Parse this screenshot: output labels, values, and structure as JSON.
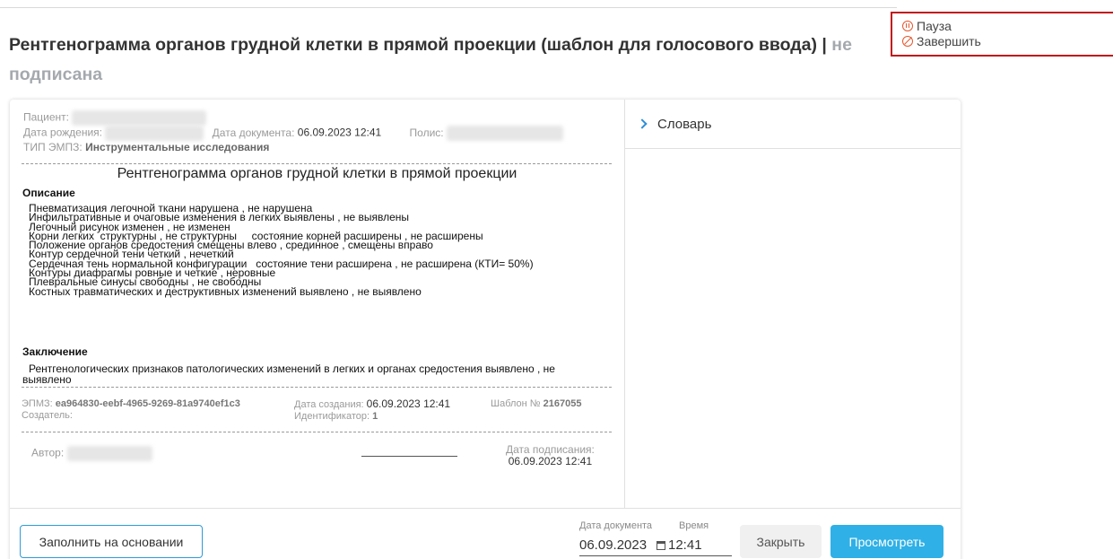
{
  "header": {
    "title": "Рентгенограмма органов грудной клетки в прямой проекции (шаблон для голосового ввода) |",
    "status": "не подписана"
  },
  "dictation": {
    "pause_label": "Пауза",
    "finish_label": "Завершить"
  },
  "doc": {
    "patient_label": "Пациент:",
    "dob_label": "Дата рождения:",
    "doc_date_label": "Дата документа:",
    "doc_date_value": "06.09.2023 12:41",
    "policy_label": "Полис:",
    "emp_type_label": "ТИП ЭМПЗ:",
    "emp_type_value": "Инструментальные исследования",
    "title": "Рентгенограмма органов грудной клетки в прямой проекции",
    "description_header": "Описание",
    "description_lines": [
      "Пневматизация легочной ткани нарушена , не нарушена",
      "Инфильтративные и очаговые изменения в легких выявлены , не выявлены",
      "Легочный рисунок изменен , не изменен",
      "Корни легких  структурны , не структурны     состояние корней расширены , не расширены",
      "Положение органов средостения смещены влево , срединное , смещены вправо",
      "Контур сердечной тени четкий , нечеткий",
      "Сердечная тень нормальной конфигурации   состояние тени расширена , не расширена (КТИ= 50%)",
      "Контуры диафрагмы ровные и четкие , неровные",
      "Плевральные синусы свободны , не свободны",
      "Костных травматических и деструктивных изменений выявлено , не выявлено"
    ],
    "conclusion_header": "Заключение",
    "conclusion_text": "Рентгенологических признаков патологических изменений в легких и органах средостения выявлено , не выявлено",
    "emp_label": "ЭПМЗ:",
    "emp_id": "ea964830-eebf-4965-9269-81a9740ef1c3",
    "creator_label": "Создатель:",
    "created_label": "Дата создания:",
    "created_value": "06.09.2023 12:41",
    "identifier_label": "Идентификатор:",
    "identifier_value": "1",
    "template_label": "Шаблон №",
    "template_value": "2167055",
    "author_label": "Автор:",
    "signed_label": "Дата подписания:",
    "signed_value": "06.09.2023 12:41"
  },
  "sidebar": {
    "dictionary_label": "Словарь"
  },
  "footer": {
    "fill_button": "Заполнить на основании",
    "date_label": "Дата документа",
    "date_value": "06.09.2023",
    "time_label": "Время",
    "time_value": "12:41",
    "close_button": "Закрыть",
    "view_button": "Просмотреть"
  },
  "colors": {
    "accent": "#2fb0e6",
    "highlight_border": "#c0161b",
    "icon": "#e4572e"
  }
}
